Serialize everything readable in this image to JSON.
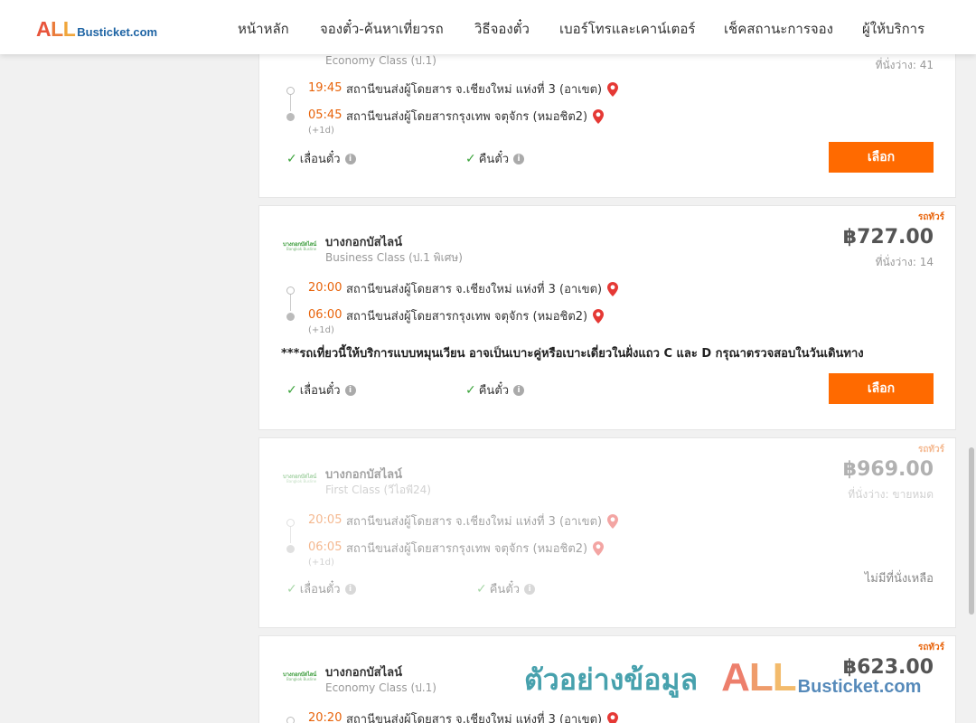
{
  "header": {
    "logo": {
      "all": [
        "A",
        "L",
        "L"
      ],
      "rest": "Busticket.com"
    },
    "nav": [
      {
        "label": "หน้าหลัก"
      },
      {
        "label": "จองตั๋ว-ค้นหาเที่ยวรถ"
      },
      {
        "label": "วิธีจองตั๋ว"
      },
      {
        "label": "เบอร์โทรและเคาน์เตอร์"
      },
      {
        "label": "เช็คสถานะการจอง"
      },
      {
        "label": "ผู้ให้บริการ"
      }
    ]
  },
  "common": {
    "transfer": "เลื่อนตั๋ว",
    "refund": "คืนตั๋ว",
    "select": "เลือก",
    "plus1": "(+1d)",
    "tag": "รถทัวร์",
    "info": "i"
  },
  "trips": [
    {
      "bus_class": "Economy Class (ป.1)",
      "seats": "ที่นั่งว่าง: 41",
      "depart_time": "19:45",
      "depart_station": "สถานีขนส่งผู้โดยสาร จ.เชียงใหม่ แห่งที่ 3 (อาเขต)",
      "arrive_time": "05:45",
      "arrive_station": "สถานีขนส่งผู้โดยสารกรุงเทพ จตุจักร (หมอชิต2)"
    },
    {
      "operator": "บางกอกบัสไลน์",
      "bus_class": "Business Class (ป.1 พิเศษ)",
      "price": "฿727.00",
      "seats": "ที่นั่งว่าง: 14",
      "depart_time": "20:00",
      "depart_station": "สถานีขนส่งผู้โดยสาร จ.เชียงใหม่ แห่งที่ 3 (อาเขต)",
      "arrive_time": "06:00",
      "arrive_station": "สถานีขนส่งผู้โดยสารกรุงเทพ จตุจักร (หมอชิต2)",
      "note": "***รถเที่ยวนี้ให้บริการแบบหมุนเวียน อาจเป็นเบาะคู่หรือเบาะเดี่ยวในฝั่งแถว C และ D กรุณาตรวจสอบในวันเดินทาง"
    },
    {
      "operator": "บางกอกบัสไลน์",
      "bus_class": "First Class (วีไอพี24)",
      "price": "฿969.00",
      "seats": "ที่นั่งว่าง: ขายหมด",
      "depart_time": "20:05",
      "depart_station": "สถานีขนส่งผู้โดยสาร จ.เชียงใหม่ แห่งที่ 3 (อาเขต)",
      "arrive_time": "06:05",
      "arrive_station": "สถานีขนส่งผู้โดยสารกรุงเทพ จตุจักร (หมอชิต2)",
      "sold_out": "ไม่มีที่นั่งเหลือ"
    },
    {
      "operator": "บางกอกบัสไลน์",
      "bus_class": "Economy Class (ป.1)",
      "price": "฿623.00",
      "depart_time": "20:20",
      "depart_station": "สถานีขนส่งผู้โดยสาร จ.เชียงใหม่ แห่งที่ 3 (อาเขต)"
    }
  ],
  "watermark": {
    "thai": "ตัวอย่างข้อมูล",
    "all": [
      "A",
      "L",
      "L"
    ],
    "rest": "Busticket.com"
  },
  "colors": {
    "accent": "#ff6a00",
    "time": "#e8630a",
    "check": "#3aa33a",
    "pin": "#e53935"
  }
}
